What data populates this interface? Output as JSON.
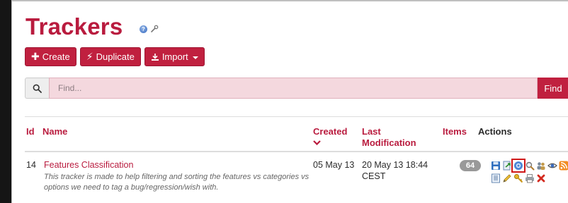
{
  "page": {
    "title": "Trackers"
  },
  "toolbar": {
    "create_label": "Create",
    "duplicate_label": "Duplicate",
    "import_label": "Import"
  },
  "search": {
    "placeholder": "Find...",
    "value": "",
    "button_label": "Find"
  },
  "table": {
    "columns": {
      "id": "Id",
      "name": "Name",
      "created": "Created",
      "last_modification": "Last Modification",
      "items": "Items",
      "actions": "Actions"
    },
    "rows": [
      {
        "id": "14",
        "name": "Features Classification",
        "description": "This tracker is made to help filtering and sorting the features vs categories vs options we need to tag a bug/regression/wish with.",
        "created": "05 May 13",
        "last_modification": "20 May 13 18:44 CEST",
        "items": "64"
      }
    ]
  },
  "icons": {
    "title_help": "help-icon",
    "title_admin": "wrench-icon",
    "actions_row1": [
      "save-icon",
      "export-icon",
      "fields-icon",
      "view-icon",
      "groups-icon",
      "monitor-icon",
      "rss-icon"
    ],
    "actions_row2": [
      "list-icon",
      "edit-icon",
      "key-icon",
      "print-icon",
      "delete-icon"
    ],
    "selected_action": "fields-icon"
  },
  "colors": {
    "brand": "#b91b3e",
    "button": "#c0203f",
    "search_background": "#f4d8de",
    "badge": "#999999",
    "selection_outline": "#d01818"
  }
}
